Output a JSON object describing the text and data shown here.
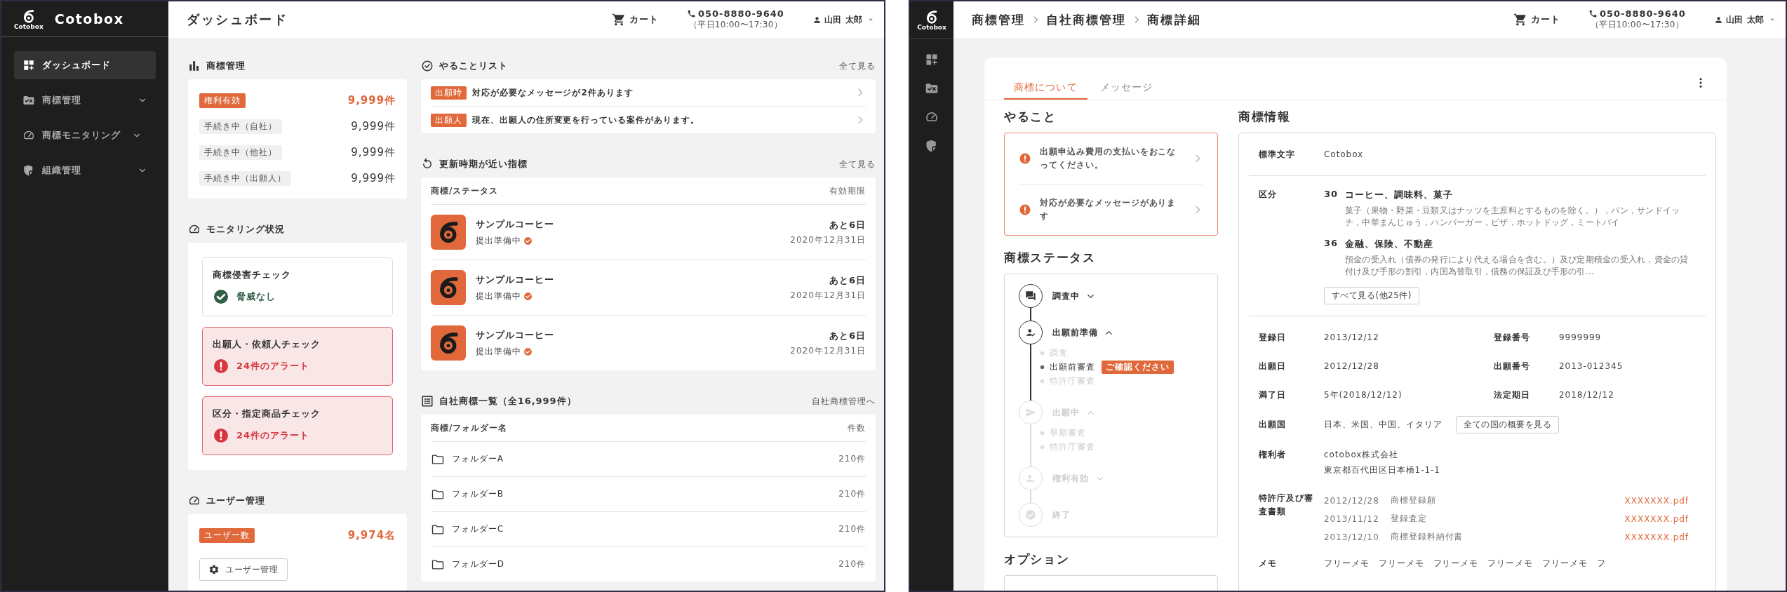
{
  "dashboard": {
    "brand": {
      "logo_caption": "Cotobox",
      "name": "Cotobox"
    },
    "sidebar": [
      {
        "label": "ダッシュボード",
        "selected": true,
        "has_submenu": false
      },
      {
        "label": "商標管理",
        "selected": false,
        "has_submenu": true
      },
      {
        "label": "商標モニタリング",
        "selected": false,
        "has_submenu": true
      },
      {
        "label": "組織管理",
        "selected": false,
        "has_submenu": true
      }
    ],
    "header": {
      "title": "ダッシュボード",
      "cart": "カート",
      "phone": "050-8880-9640",
      "hours": "（平日10:00〜17:30）",
      "user": "山田 太郎"
    },
    "trademarks": {
      "title": "商標管理",
      "rows": [
        {
          "label": "権利有効",
          "count": "9,999件",
          "highlight": true
        },
        {
          "label": "手続き中（自社）",
          "count": "9,999件",
          "highlight": false
        },
        {
          "label": "手続き中（他社）",
          "count": "9,999件",
          "highlight": false
        },
        {
          "label": "手続き中（出願人）",
          "count": "9,999件",
          "highlight": false
        }
      ]
    },
    "monitoring": {
      "title": "モニタリング状況",
      "checks": [
        {
          "title": "商標侵害チェック",
          "status": "脅威なし",
          "alert": false
        },
        {
          "title": "出願人・依頼人チェック",
          "status": "24件のアラート",
          "alert": true
        },
        {
          "title": "区分・指定商品チェック",
          "status": "24件のアラート",
          "alert": true
        }
      ]
    },
    "users": {
      "title": "ユーザー管理",
      "label": "ユーザー数",
      "count": "9,974名",
      "button": "ユーザー管理"
    },
    "todo": {
      "title": "やることリスト",
      "link": "全て見る",
      "items": [
        {
          "tag": "出願時",
          "text": "対応が必要なメッセージが2件あります"
        },
        {
          "tag": "出願人",
          "text": "現在、出願人の住所変更を行っている案件があります。"
        }
      ]
    },
    "renewals": {
      "title": "更新時期が近い指標",
      "link": "全て見る",
      "columns": [
        "商標/ステータス",
        "有効期限"
      ],
      "rows": [
        {
          "name": "サンプルコーヒー",
          "status": "提出準備中",
          "remaining": "あと6日",
          "date": "2020年12月31日"
        },
        {
          "name": "サンプルコーヒー",
          "status": "提出準備中",
          "remaining": "あと6日",
          "date": "2020年12月31日"
        },
        {
          "name": "サンプルコーヒー",
          "status": "提出準備中",
          "remaining": "あと6日",
          "date": "2020年12月31日"
        }
      ]
    },
    "own_trademarks": {
      "title": "自社商標一覧（全16,999件）",
      "link": "自社商標管理へ",
      "columns": [
        "商標/フォルダー名",
        "件数"
      ],
      "rows": [
        {
          "name": "フォルダーA",
          "count": "210件"
        },
        {
          "name": "フォルダーB",
          "count": "210件"
        },
        {
          "name": "フォルダーC",
          "count": "210件"
        },
        {
          "name": "フォルダーD",
          "count": "210件"
        }
      ]
    }
  },
  "detail": {
    "brand": {
      "logo_caption": "Cotobox"
    },
    "header": {
      "breadcrumb": [
        "商標管理",
        "自社商標管理",
        "商標詳細"
      ],
      "cart": "カート",
      "phone": "050-8880-9640",
      "hours": "（平日10:00〜17:30）",
      "user": "山田 太郎"
    },
    "tabs": [
      {
        "label": "商標について",
        "selected": true
      },
      {
        "label": "メッセージ",
        "selected": false
      }
    ],
    "todo": {
      "title": "やること",
      "items": [
        "出願申込み費用の支払いをおこなってください。",
        "対応が必要なメッセージがあります"
      ]
    },
    "status": {
      "title": "商標ステータス",
      "steps": [
        {
          "label": "調査中",
          "active": true,
          "collapsible": true,
          "expanded": false
        },
        {
          "label": "出願前準備",
          "active": true,
          "collapsible": true,
          "expanded": true,
          "children": [
            {
              "label": "調査",
              "current": false
            },
            {
              "label": "出願前審査",
              "current": true,
              "badge": "ご確認ください"
            },
            {
              "label": "特許庁審査",
              "current": false
            }
          ]
        },
        {
          "label": "出願中",
          "active": false,
          "collapsible": true,
          "expanded": true,
          "children": [
            {
              "label": "早期審査",
              "current": false
            },
            {
              "label": "特許庁審査",
              "current": false
            }
          ]
        },
        {
          "label": "権利有効",
          "active": false,
          "collapsible": true,
          "expanded": false
        },
        {
          "label": "終了",
          "active": false,
          "collapsible": false
        }
      ]
    },
    "options": {
      "title": "オプション"
    },
    "info": {
      "title": "商標情報",
      "standard_chars_label": "標準文字",
      "standard_chars": "Cotobox",
      "classes_label": "区分",
      "classes": [
        {
          "number": "30",
          "title": "コーヒー、調味料、菓子",
          "goods": "菓子（果物・野菜・豆類又はナッツを主原料とするものを除く。），パン，サンドイッチ，中華まんじゅう，ハンバーガー，ピザ，ホットドッグ，ミートパイ"
        },
        {
          "number": "36",
          "title": "金融、保険、不動産",
          "goods": "預金の受入れ（債券の発行により代える場合を含む。）及び定期積金の受入れ，資金の貸付け及び手形の割引，内国為替取引，債務の保証及び手形の引…"
        }
      ],
      "more_button": "すべて見る(他25件)",
      "fields": [
        {
          "label": "登録日",
          "value": "2013/12/12"
        },
        {
          "label": "登録番号",
          "value": "9999999"
        },
        {
          "label": "出願日",
          "value": "2012/12/28"
        },
        {
          "label": "出願番号",
          "value": "2013-012345"
        },
        {
          "label": "満了日",
          "value": "5年(2018/12/12)"
        },
        {
          "label": "法定期日",
          "value": "2018/12/12"
        }
      ],
      "countries_label": "出願国",
      "countries": "日本、米国、中国、イタリア",
      "countries_button": "全ての国の概要を見る",
      "holder_label": "権利者",
      "holder_name": "cotobox株式会社",
      "holder_address": "東京都百代田区日本橋1-1-1",
      "documents_label": "特許庁及び審査書類",
      "documents": [
        {
          "date": "2012/12/28",
          "name": "商標登録願",
          "file": "XXXXXXX.pdf"
        },
        {
          "date": "2013/11/12",
          "name": "登録査定",
          "file": "XXXXXXX.pdf"
        },
        {
          "date": "2013/12/10",
          "name": "商標登録料納付書",
          "file": "XXXXXXX.pdf"
        }
      ],
      "memo_label": "メモ",
      "memo": "フリーメモ　フリーメモ　フリーメモ　フリーメモ　フリーメモ　フ"
    }
  }
}
